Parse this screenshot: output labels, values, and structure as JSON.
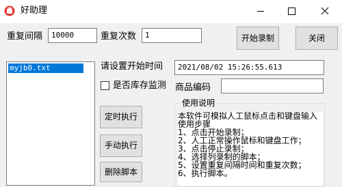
{
  "window": {
    "title": "好助理",
    "icon": "red-hand-icon"
  },
  "repeat_interval": {
    "label": "重复间隔",
    "value": "10000"
  },
  "repeat_count": {
    "label": "重复次数",
    "value": "1"
  },
  "buttons": {
    "start_record": "开始录制",
    "close": "关闭",
    "timed_execute": "定时执行",
    "manual_execute": "手动执行",
    "delete_script": "删除脚本"
  },
  "script_list": [
    "myjb0.txt"
  ],
  "start_time": {
    "label": "请设置开始时间",
    "value": "2021/08/02 15:26:55.613"
  },
  "inventory_monitor": {
    "label": "是否库存监测",
    "checked": false
  },
  "product_code": {
    "label": "商品编码",
    "value": ""
  },
  "instructions": {
    "title": "使用说明",
    "lines": [
      "本软件可模拟人工鼠标点击和键盘输入",
      "使用步骤",
      "1、点击开始录制；",
      "2、人工正常操作鼠标和键盘工作；",
      "3、点击停止录制；",
      "4、选择列录制的脚本；",
      "5、设置重复间隔时间和重复次数；",
      "6、执行脚本。"
    ]
  },
  "colors": {
    "selection": "#0078d7",
    "app_icon": "#e53935"
  }
}
